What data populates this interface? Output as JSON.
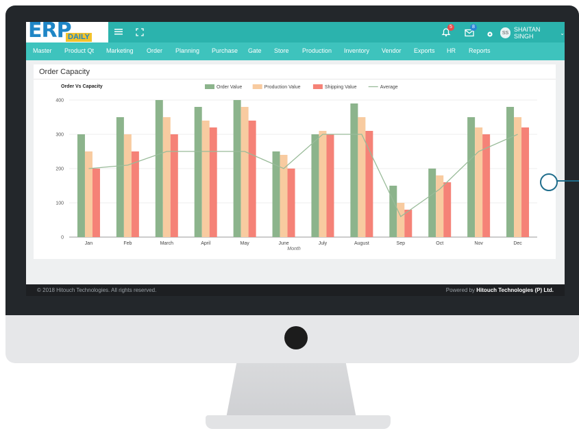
{
  "app": {
    "logo_main": "ERP",
    "logo_sub": "DAILY",
    "notifications_count": "5",
    "messages_count": "8",
    "user_name": "SHAITAN SINGH",
    "avatar_initials": "SS"
  },
  "menu": [
    "Master",
    "Product Qt",
    "Marketing",
    "Order",
    "Planning",
    "Purchase",
    "Gate",
    "Store",
    "Production",
    "Inventory",
    "Vendor",
    "Exports",
    "HR",
    "Reports"
  ],
  "panel": {
    "title": "Order Capacity"
  },
  "chart_data": {
    "type": "bar",
    "title": "Order Vs Capacity",
    "xlabel": "Month",
    "ylabel": "",
    "ylim": [
      0,
      400
    ],
    "yticks": [
      0,
      100,
      200,
      300,
      400
    ],
    "grid": true,
    "legend": "top-center",
    "categories": [
      "Jan",
      "Feb",
      "March",
      "April",
      "May",
      "June",
      "July",
      "August",
      "Sep",
      "Oct",
      "Nov",
      "Dec"
    ],
    "series": [
      {
        "name": "Order Value",
        "kind": "bar",
        "color": "#8cb48c",
        "values": [
          300,
          350,
          400,
          380,
          400,
          250,
          300,
          390,
          150,
          200,
          350,
          380
        ]
      },
      {
        "name": "Production Value",
        "kind": "bar",
        "color": "#f8cba0",
        "values": [
          250,
          300,
          350,
          340,
          380,
          240,
          310,
          350,
          100,
          180,
          320,
          350
        ]
      },
      {
        "name": "Shipping Value",
        "kind": "bar",
        "color": "#f58277",
        "values": [
          200,
          250,
          300,
          320,
          340,
          200,
          300,
          310,
          80,
          160,
          300,
          320
        ]
      },
      {
        "name": "Average",
        "kind": "line",
        "color": "#99bb99",
        "values": [
          200,
          210,
          250,
          250,
          250,
          200,
          300,
          300,
          60,
          140,
          250,
          300
        ]
      }
    ]
  },
  "footer": {
    "copyright": "© 2018 Hitouch Technologies. All rights reserved.",
    "powered_prefix": "Powered by",
    "powered_company": "Hitouch Technologies (P) Ltd."
  }
}
